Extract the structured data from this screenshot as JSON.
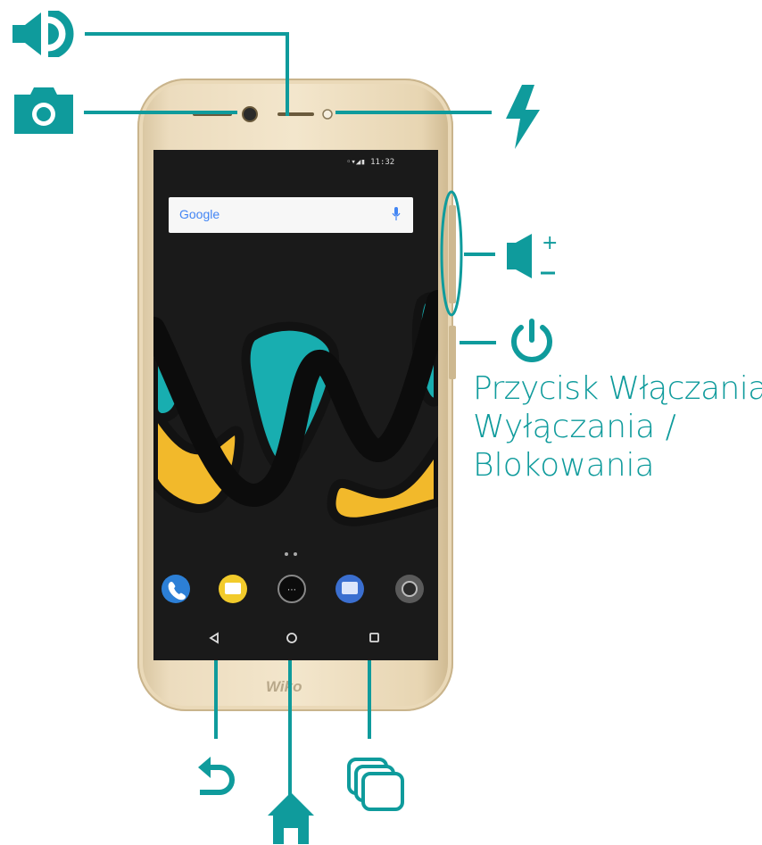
{
  "colors": {
    "accent": "#0f9b9c",
    "phone_gold": "#ecdcbe",
    "screen": "#1a1a1a",
    "wave_yellow": "#f2b92b",
    "wave_teal": "#18aeb0"
  },
  "phone": {
    "search_text": "Google",
    "status_time": "11:32",
    "brand_logo": "Wiko"
  },
  "callouts": {
    "speaker_icon": "speaker-icon",
    "camera_icon": "camera-icon",
    "flash_icon": "flash-icon",
    "volume_icon": "volume-plus-minus-icon",
    "power_icon": "power-icon",
    "back_icon": "back-arrow-icon",
    "home_icon": "home-icon",
    "recents_icon": "recent-apps-icon"
  },
  "power_label": {
    "line1": "Przycisk Włączania",
    "line2": "Wyłączania /",
    "line3": "Blokowania"
  },
  "dock_apps": [
    "phone-app-icon",
    "messages-app-icon",
    "app-drawer-icon",
    "chat-app-icon",
    "camera-app-icon"
  ]
}
